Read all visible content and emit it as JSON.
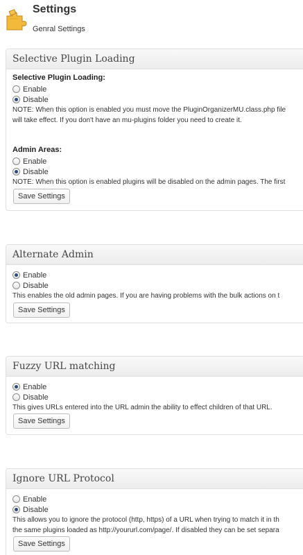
{
  "header": {
    "title": "Settings",
    "subtitle": "Genral Settings",
    "icon": "puzzle-icon"
  },
  "colors": {
    "panel_border": "#dfdfdf",
    "radio_dot": "#2b4a7a",
    "text": "#333333"
  },
  "panels": {
    "selective": {
      "title": "Selective Plugin Loading",
      "field1_label": "Selective Plugin Loading:",
      "field1_options": [
        "Enable",
        "Disable"
      ],
      "field1_selected": "Disable",
      "field1_note_line1": "NOTE: When this option is enabled you must move the PluginOrganizerMU.class.php file",
      "field1_note_line2": "will take effect. If you don't have an mu-plugins folder you need to create it.",
      "field2_label": "Admin Areas:",
      "field2_options": [
        "Enable",
        "Disable"
      ],
      "field2_selected": "Disable",
      "field2_note": "NOTE: When this option is enabled plugins will be disabled on the admin pages. The first",
      "save_label": "Save Settings"
    },
    "alternate_admin": {
      "title": "Alternate Admin",
      "options": [
        "Enable",
        "Disable"
      ],
      "selected": "Enable",
      "note": "This enables the old admin pages. If you are having problems with the bulk actions on t",
      "save_label": "Save Settings"
    },
    "fuzzy_url": {
      "title": "Fuzzy URL matching",
      "options": [
        "Enable",
        "Disable"
      ],
      "selected": "Enable",
      "note": "This gives URLs entered into the URL admin the ability to effect children of that URL.",
      "save_label": "Save Settings"
    },
    "ignore_protocol": {
      "title": "Ignore URL Protocol",
      "options": [
        "Enable",
        "Disable"
      ],
      "selected": "Disable",
      "note_line1": "This allows you to ignore the protocol (http, https) of a URL when trying to match it in th",
      "note_line2": "the same plugins loaded as http://yoururl.com/page/. If disabled they can be set separa",
      "save_label": "Save Settings"
    }
  }
}
